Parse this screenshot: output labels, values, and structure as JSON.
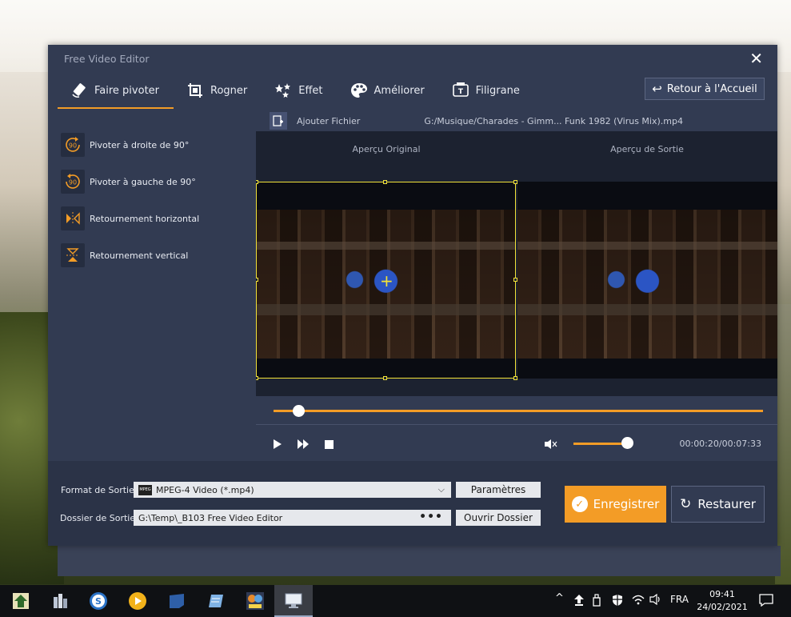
{
  "app": {
    "title": "Free Video Editor",
    "close_glyph": "✕"
  },
  "tabs": [
    {
      "label": "Faire pivoter",
      "icon": "rotate-icon",
      "active": true
    },
    {
      "label": "Rogner",
      "icon": "crop-icon",
      "active": false
    },
    {
      "label": "Effet",
      "icon": "effect-stars-icon",
      "active": false
    },
    {
      "label": "Améliorer",
      "icon": "palette-icon",
      "active": false
    },
    {
      "label": "Filigrane",
      "icon": "watermark-icon",
      "active": false
    }
  ],
  "back_button": {
    "label": "Retour à l'Accueil"
  },
  "sidebar": {
    "items": [
      {
        "label": "Pivoter à droite de 90°",
        "icon_text": "90"
      },
      {
        "label": "Pivoter à gauche de 90°",
        "icon_text": "90"
      },
      {
        "label": "Retournement horizontal"
      },
      {
        "label": "Retournement vertical"
      }
    ]
  },
  "filebar": {
    "add_label": "Ajouter Fichier",
    "path": "G:/Musique/Charades - Gimm... Funk 1982 (Virus Mix).mp4"
  },
  "preview": {
    "original_label": "Aperçu Original",
    "output_label": "Aperçu de Sortie"
  },
  "player": {
    "progress_fraction": 0.04,
    "volume_fraction": 0.85,
    "time": "00:00:20/00:07:33"
  },
  "bottom": {
    "format_label": "Format de Sortie:",
    "format_value": "MPEG-4 Video (*.mp4)",
    "format_badge": "MPEG",
    "params_button": "Paramètres",
    "folder_label": "Dossier de Sortie:",
    "folder_value": "G:\\Temp\\_B103 Free Video Editor",
    "folder_dots": "•••",
    "open_folder_button": "Ouvrir Dossier",
    "save_button": "Enregistrer",
    "restore_button": "Restaurer"
  },
  "taskbar": {
    "language": "FRA",
    "time": "09:41",
    "date": "24/02/2021"
  },
  "colors": {
    "accent": "#f39c26",
    "window_bg": "#323b52",
    "crop_frame": "#f2e238"
  }
}
